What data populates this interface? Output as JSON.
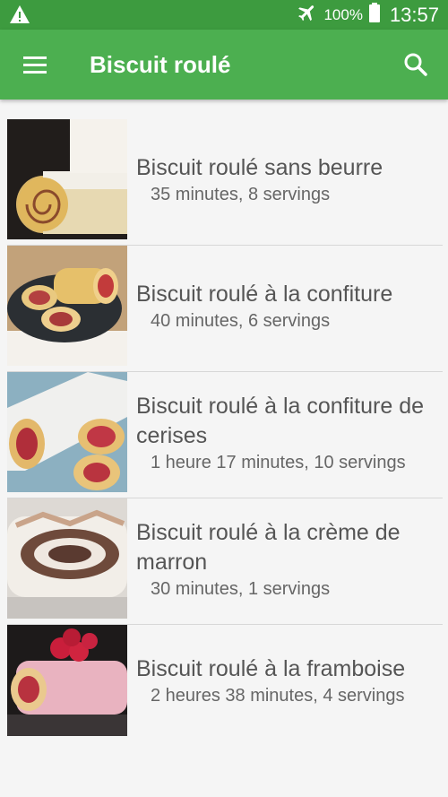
{
  "status": {
    "battery": "100%",
    "time": "13:57",
    "warning_icon": "warning-icon",
    "airplane_icon": "airplane-icon",
    "battery_icon": "battery-icon"
  },
  "appbar": {
    "title": "Biscuit roulé",
    "menu_icon": "menu-icon",
    "search_icon": "search-icon",
    "color": "#4caf50",
    "status_color": "#3d9b3f"
  },
  "recipes": [
    {
      "title": "Biscuit roulé sans beurre",
      "meta": "35 minutes, 8 servings"
    },
    {
      "title": "Biscuit roulé à la confiture",
      "meta": "40 minutes, 6 servings"
    },
    {
      "title": "Biscuit roulé à la confiture de cerises",
      "meta": "1 heure 17 minutes, 10 servings"
    },
    {
      "title": "Biscuit roulé à la crème de marron",
      "meta": "30 minutes, 1 servings"
    },
    {
      "title": "Biscuit roulé à la framboise",
      "meta": "2 heures 38 minutes, 4 servings"
    }
  ]
}
